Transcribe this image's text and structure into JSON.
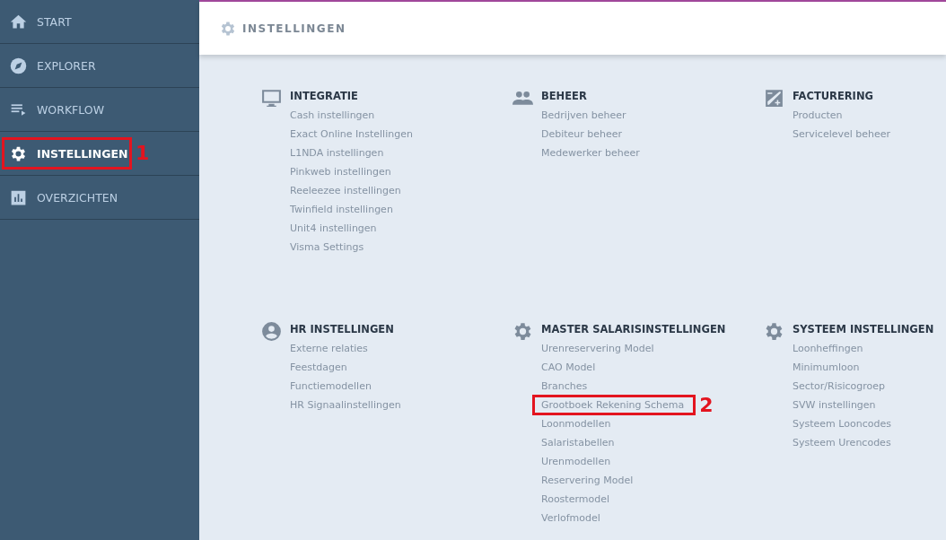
{
  "sidebar": {
    "items": [
      {
        "label": "START",
        "kind": "home",
        "selected": false
      },
      {
        "label": "EXPLORER",
        "kind": "compass",
        "selected": false
      },
      {
        "label": "WORKFLOW",
        "kind": "playlist",
        "selected": false
      },
      {
        "label": "INSTELLINGEN",
        "kind": "gear",
        "selected": true,
        "callout": "1"
      },
      {
        "label": "OVERZICHTEN",
        "kind": "chart",
        "selected": false
      }
    ]
  },
  "header": {
    "title": "INSTELLINGEN"
  },
  "sections": [
    {
      "title": "INTEGRATIE",
      "kind": "monitor",
      "links": [
        {
          "label": "Cash instellingen"
        },
        {
          "label": "Exact Online Instellingen"
        },
        {
          "label": "L1NDA instellingen"
        },
        {
          "label": "Pinkweb instellingen"
        },
        {
          "label": "Reeleezee instellingen"
        },
        {
          "label": "Twinfield instellingen"
        },
        {
          "label": "Unit4 instellingen"
        },
        {
          "label": "Visma Settings"
        }
      ]
    },
    {
      "title": "BEHEER",
      "kind": "people",
      "links": [
        {
          "label": "Bedrijven beheer"
        },
        {
          "label": "Debiteur beheer"
        },
        {
          "label": "Medewerker beheer"
        }
      ]
    },
    {
      "title": "FACTURERING",
      "kind": "invoice",
      "links": [
        {
          "label": "Producten"
        },
        {
          "label": "Servicelevel beheer"
        }
      ]
    },
    {
      "title": "HR INSTELLINGEN",
      "kind": "person",
      "links": [
        {
          "label": "Externe relaties"
        },
        {
          "label": "Feestdagen"
        },
        {
          "label": "Functiemodellen"
        },
        {
          "label": "HR Signaalinstellingen"
        }
      ]
    },
    {
      "title": "MASTER SALARISINSTELLINGEN",
      "kind": "gear",
      "links": [
        {
          "label": "Urenreservering Model"
        },
        {
          "label": "CAO Model"
        },
        {
          "label": "Branches"
        },
        {
          "label": "Grootboek Rekening Schema",
          "callout": "2"
        },
        {
          "label": "Loonmodellen"
        },
        {
          "label": "Salaristabellen"
        },
        {
          "label": "Urenmodellen"
        },
        {
          "label": "Reservering Model"
        },
        {
          "label": "Roostermodel"
        },
        {
          "label": "Verlofmodel"
        }
      ]
    },
    {
      "title": "SYSTEEM INSTELLINGEN",
      "kind": "gear",
      "links": [
        {
          "label": "Loonheffingen"
        },
        {
          "label": "Minimumloon"
        },
        {
          "label": "Sector/Risicogroep"
        },
        {
          "label": "SVW instellingen"
        },
        {
          "label": "Systeem Looncodes"
        },
        {
          "label": "Systeem Urencodes"
        }
      ]
    }
  ]
}
